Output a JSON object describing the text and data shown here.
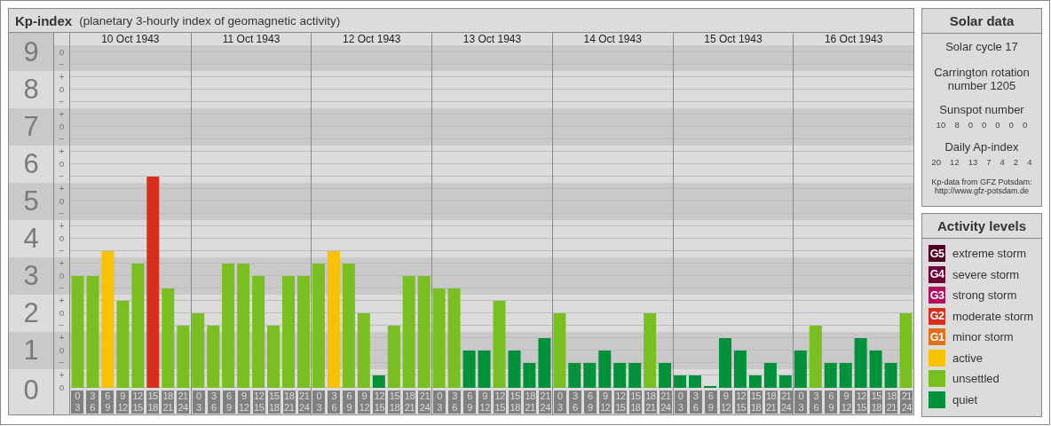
{
  "kp_panel": {
    "title": "Kp-index",
    "subtitle": "(planetary 3-hourly index of geomagnetic activity)",
    "sub_marks": [
      [
        "o",
        "−"
      ],
      [
        "+",
        "o",
        "−"
      ],
      [
        "+",
        "o",
        "−"
      ],
      [
        "+",
        "o",
        "−"
      ],
      [
        "+",
        "o",
        "−"
      ],
      [
        "+",
        "o",
        "−"
      ],
      [
        "+",
        "o",
        "−"
      ],
      [
        "+",
        "o",
        "−"
      ],
      [
        "+",
        "o",
        "−"
      ],
      [
        "+",
        "o"
      ]
    ],
    "days": [
      {
        "date": "10 Oct 1943"
      },
      {
        "date": "11 Oct 1943"
      },
      {
        "date": "12 Oct 1943"
      },
      {
        "date": "13 Oct 1943"
      },
      {
        "date": "14 Oct 1943"
      },
      {
        "date": "15 Oct 1943"
      },
      {
        "date": "16 Oct 1943"
      }
    ],
    "chart_data": {
      "type": "bar",
      "grid": true,
      "ylim": [
        0,
        9.19
      ],
      "bands": [
        {
          "axis": "y",
          "from": 0.5,
          "to": 1.5,
          "color": "#c9c9c9"
        },
        {
          "axis": "y",
          "from": 2.5,
          "to": 3.5,
          "color": "#c9c9c9"
        },
        {
          "axis": "y",
          "from": 4.5,
          "to": 5.5,
          "color": "#c9c9c9"
        },
        {
          "axis": "y",
          "from": 6.5,
          "to": 7.5,
          "color": "#c9c9c9"
        },
        {
          "axis": "y",
          "from": 8.5,
          "to": 9.5,
          "color": "#c9c9c9"
        }
      ],
      "yticks": [
        9,
        8,
        7,
        6,
        5,
        4,
        3,
        2,
        1,
        0
      ],
      "categories": [
        "0 3",
        "3 6",
        "6 9",
        "9 12",
        "12 15",
        "15 18",
        "18 21",
        "21 24",
        "0 3",
        "3 6",
        "6 9",
        "9 12",
        "12 15",
        "15 18",
        "18 21",
        "21 24",
        "0 3",
        "3 6",
        "6 9",
        "9 12",
        "12 15",
        "15 18",
        "18 21",
        "21 24",
        "0 3",
        "3 6",
        "6 9",
        "9 12",
        "12 15",
        "15 18",
        "18 21",
        "21 24",
        "0 3",
        "3 6",
        "6 9",
        "9 12",
        "12 15",
        "15 18",
        "18 21",
        "21 24",
        "0 3",
        "3 6",
        "6 9",
        "9 12",
        "12 15",
        "15 18",
        "18 21",
        "21 24",
        "0 3",
        "3 6",
        "6 9",
        "9 12",
        "12 15",
        "15 18",
        "18 21",
        "21 24"
      ],
      "series": [
        {
          "color": "#00913a",
          "values": [
            null,
            null,
            null,
            null,
            null,
            null,
            null,
            null,
            null,
            null,
            null,
            null,
            null,
            null,
            null,
            null,
            null,
            null,
            null,
            null,
            0.33,
            null,
            null,
            null,
            null,
            null,
            1,
            1,
            null,
            1,
            0.67,
            1.33,
            null,
            0.67,
            0.67,
            1,
            0.67,
            0.67,
            null,
            0.67,
            0.33,
            0.33,
            0,
            1.33,
            1,
            0.33,
            0.67,
            0.33,
            1,
            null,
            0.67,
            0.67,
            1.33,
            1,
            0.67,
            null
          ]
        },
        {
          "color": "#7abf22",
          "values": [
            3,
            3,
            null,
            2.33,
            3.33,
            null,
            2.67,
            1.67,
            2,
            1.67,
            3.33,
            3.33,
            3,
            1.67,
            3,
            3,
            3.33,
            null,
            3.33,
            2,
            null,
            1.67,
            3,
            3,
            2.67,
            2.67,
            null,
            null,
            2.33,
            null,
            null,
            null,
            2,
            null,
            null,
            null,
            null,
            null,
            2,
            null,
            null,
            null,
            null,
            null,
            null,
            null,
            null,
            null,
            null,
            1.67,
            null,
            null,
            null,
            null,
            null,
            2
          ]
        },
        {
          "color": "#f7c300",
          "values": [
            null,
            null,
            3.67,
            null,
            null,
            null,
            null,
            null,
            null,
            null,
            null,
            null,
            null,
            null,
            null,
            null,
            null,
            3.67,
            null,
            null,
            null,
            null,
            null,
            null,
            null,
            null,
            null,
            null,
            null,
            null,
            null,
            null,
            null,
            null,
            null,
            null,
            null,
            null,
            null,
            null,
            null,
            null,
            null,
            null,
            null,
            null,
            null,
            null,
            null,
            null,
            null,
            null,
            null,
            null,
            null,
            null
          ]
        },
        {
          "color": "#d82e1e",
          "values": [
            null,
            null,
            null,
            null,
            null,
            5.67,
            null,
            null,
            null,
            null,
            null,
            null,
            null,
            null,
            null,
            null,
            null,
            null,
            null,
            null,
            null,
            null,
            null,
            null,
            null,
            null,
            null,
            null,
            null,
            null,
            null,
            null,
            null,
            null,
            null,
            null,
            null,
            null,
            null,
            null,
            null,
            null,
            null,
            null,
            null,
            null,
            null,
            null,
            null,
            null,
            null,
            null,
            null,
            null,
            null,
            null
          ]
        }
      ]
    }
  },
  "solar_data": {
    "title": "Solar data",
    "solar_cycle": "Solar cycle 17",
    "carrington": "Carrington rotation number 1205",
    "sunspot_label": "Sunspot number",
    "sunspot_numbers": [
      "10",
      "8",
      "0",
      "0",
      "0",
      "0",
      "0"
    ],
    "ap_label": "Daily Ap-index",
    "ap_values": [
      "20",
      "12",
      "13",
      "7",
      "4",
      "2",
      "4"
    ],
    "source": [
      "Kp-data from GFZ Potsdam:",
      "http://www.gfz-potsdam.de"
    ]
  },
  "legend": {
    "title": "Activity levels",
    "items": [
      {
        "badge": "G5",
        "label": "extreme storm",
        "color": "#4c0022"
      },
      {
        "badge": "G4",
        "label": "severe storm",
        "color": "#6d0038"
      },
      {
        "badge": "G3",
        "label": "strong storm",
        "color": "#b0105e"
      },
      {
        "badge": "G2",
        "label": "moderate storm",
        "color": "#d82e1e"
      },
      {
        "badge": "G1",
        "label": "minor storm",
        "color": "#e0701a"
      },
      {
        "label": "active",
        "color": "#f7c300"
      },
      {
        "label": "unsettled",
        "color": "#7abf22"
      },
      {
        "label": "quiet",
        "color": "#00913a"
      }
    ]
  }
}
